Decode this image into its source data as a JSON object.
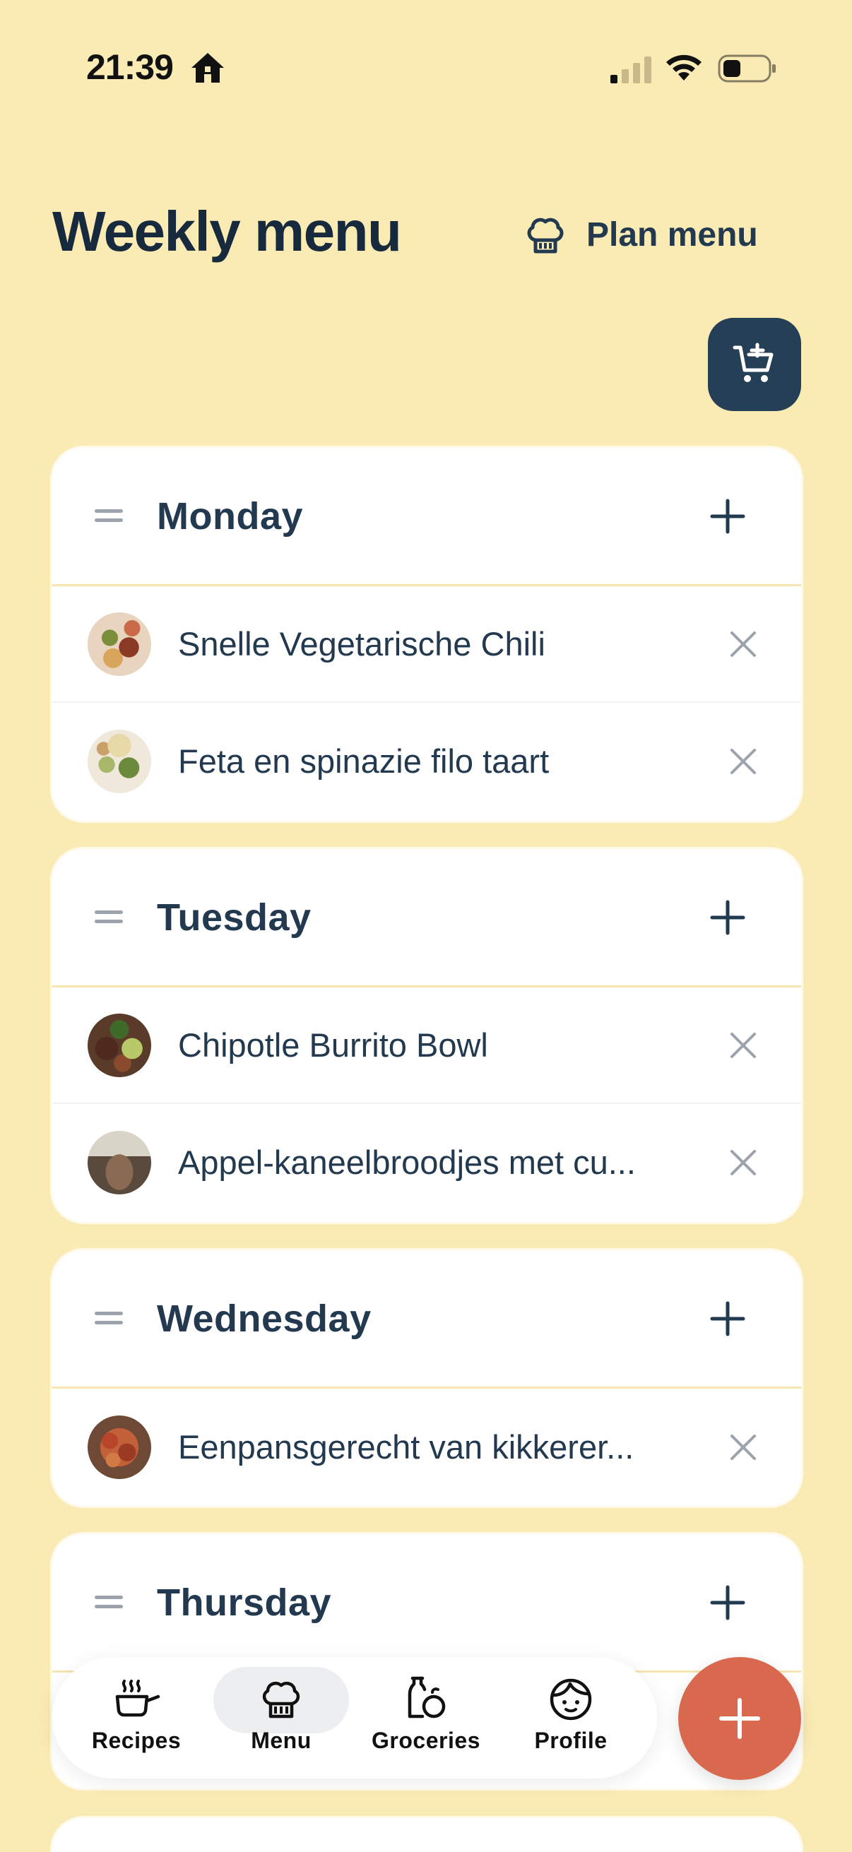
{
  "status_bar": {
    "time": "21:39"
  },
  "header": {
    "title": "Weekly menu",
    "plan_menu_label": "Plan menu"
  },
  "days": [
    {
      "name": "Monday",
      "recipes": [
        {
          "name": "Snelle Vegetarische Chili"
        },
        {
          "name": "Feta en spinazie filo taart"
        }
      ]
    },
    {
      "name": "Tuesday",
      "recipes": [
        {
          "name": "Chipotle Burrito Bowl"
        },
        {
          "name": "Appel-kaneelbroodjes met cu..."
        }
      ]
    },
    {
      "name": "Wednesday",
      "recipes": [
        {
          "name": "Eenpansgerecht van kikkerer..."
        }
      ]
    },
    {
      "name": "Thursday",
      "recipes": []
    }
  ],
  "nav": {
    "items": [
      {
        "label": "Recipes",
        "icon": "pot-icon"
      },
      {
        "label": "Menu",
        "icon": "chef-hat-icon",
        "active": true
      },
      {
        "label": "Groceries",
        "icon": "groceries-icon"
      },
      {
        "label": "Profile",
        "icon": "profile-face-icon"
      }
    ]
  },
  "colors": {
    "background": "#FAEBB4",
    "primary_dark": "#243F56",
    "fab": "#D8694E"
  }
}
